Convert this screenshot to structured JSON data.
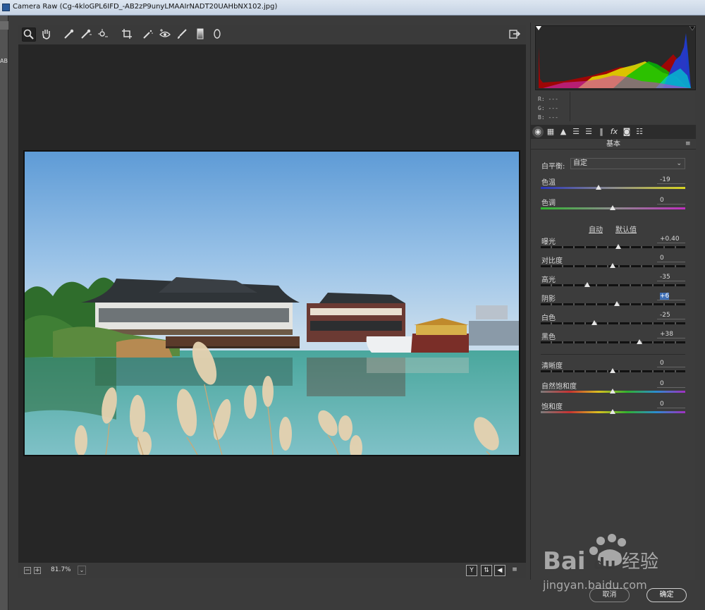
{
  "window": {
    "title": "Camera Raw (Cg-4kloGPL6IFD_-AB2zP9unyLMAAIrNADT20UAHbNX102.jpg)"
  },
  "host": {
    "ab_text": "AB"
  },
  "toolbar": {
    "tools": [
      {
        "name": "zoom-tool-icon",
        "glyph": "🔍︎"
      },
      {
        "name": "hand-tool-icon",
        "glyph": "✋︎"
      },
      {
        "name": "white-balance-tool-icon",
        "glyph": "⁄"
      },
      {
        "name": "color-sampler-tool-icon",
        "glyph": "✓"
      },
      {
        "name": "targeted-adjustment-tool-icon",
        "glyph": "⊙"
      },
      {
        "name": "crop-tool-icon",
        "glyph": "⌗"
      },
      {
        "name": "spot-removal-tool-icon",
        "glyph": "✎"
      },
      {
        "name": "red-eye-tool-icon",
        "glyph": "◉"
      },
      {
        "name": "adjustment-brush-icon",
        "glyph": "⁄"
      },
      {
        "name": "graduated-filter-icon",
        "glyph": "▮"
      },
      {
        "name": "radial-filter-icon",
        "glyph": "○"
      }
    ],
    "export_glyph": "⇥"
  },
  "status": {
    "zoom_minus": "−",
    "zoom_plus": "+",
    "zoom_value": "81.7%",
    "zoom_caret": "⌄",
    "view_y": "Y",
    "view_compare": "⇅",
    "view_swap": "◀",
    "view_settings": "≡"
  },
  "histogram": {
    "r_label": "R:",
    "r_value": "---",
    "g_label": "G:",
    "g_value": "---",
    "b_label": "B:",
    "b_value": "---"
  },
  "panel_tabs": [
    "◉",
    "▦",
    "▲",
    "☰",
    "☰",
    "‖",
    "fx",
    "◙",
    "☷"
  ],
  "basic": {
    "title": "基本",
    "menu_glyph": "≡",
    "white_balance_label": "白平衡:",
    "white_balance_value": "自定",
    "temp_label": "色温",
    "temp_value": "-19",
    "tint_label": "色调",
    "tint_value": "0",
    "auto_label": "自动",
    "default_label": "默认值",
    "exposure_label": "曝光",
    "exposure_value": "+0.40",
    "contrast_label": "对比度",
    "contrast_value": "0",
    "highlights_label": "高光",
    "highlights_value": "-35",
    "shadows_label": "阴影",
    "shadows_value": "+6",
    "whites_label": "白色",
    "whites_value": "-25",
    "blacks_label": "黑色",
    "blacks_value": "+38",
    "clarity_label": "清晰度",
    "clarity_value": "0",
    "vibrance_label": "自然饱和度",
    "vibrance_value": "0",
    "saturation_label": "饱和度",
    "saturation_value": "0"
  },
  "dialog": {
    "cancel_label": "取消",
    "ok_label": "确定"
  },
  "watermark": {
    "brand": "Bai",
    "brand2": "du",
    "jingyan": "经验",
    "url": "jingyan.baidu.com"
  }
}
